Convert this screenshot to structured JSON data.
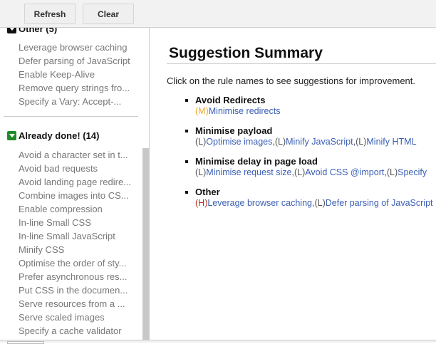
{
  "toolbar": {
    "refresh": "Refresh",
    "clear": "Clear"
  },
  "sidebar": {
    "other": {
      "label": "Other (5)",
      "items": [
        "Leverage browser caching",
        "Defer parsing of JavaScript",
        "Enable Keep-Alive",
        "Remove query strings fro...",
        "Specify a Vary: Accept-..."
      ]
    },
    "done": {
      "label": "Already done! (14)",
      "items": [
        "Avoid a character set in t...",
        "Avoid bad requests",
        "Avoid landing page redire...",
        "Combine images into CS...",
        "Enable compression",
        "In-line Small CSS",
        "In-line Small JavaScript",
        "Minify CSS",
        "Optimise the order of sty...",
        "Prefer asynchronous res...",
        "Put CSS in the documen...",
        "Serve resources from a ...",
        "Serve scaled images",
        "Specify a cache validator"
      ]
    }
  },
  "main": {
    "title": "Suggestion Summary",
    "intro": "Click on the rule names to see suggestions for improvement.",
    "rules": [
      {
        "title": "Avoid Redirects",
        "links": [
          {
            "p": "(M)",
            "c": "#f0a830",
            "t": "Minimise redirects"
          }
        ]
      },
      {
        "title": "Minimise payload",
        "links": [
          {
            "p": "(L)",
            "c": "#555",
            "t": "Optimise images"
          },
          {
            "p": "(L)",
            "c": "#555",
            "t": "Minify JavaScript"
          },
          {
            "p": "(L)",
            "c": "#555",
            "t": "Minify HTML"
          }
        ]
      },
      {
        "title": "Minimise delay in page load",
        "links": [
          {
            "p": "(L)",
            "c": "#555",
            "t": "Minimise request size"
          },
          {
            "p": "(L)",
            "c": "#555",
            "t": "Avoid CSS @import"
          },
          {
            "p": "(L)",
            "c": "#555",
            "t": "Specify"
          }
        ]
      },
      {
        "title": "Other",
        "links": [
          {
            "p": "(H)",
            "c": "#c03020",
            "t": "Leverage browser caching"
          },
          {
            "p": "(L)",
            "c": "#555",
            "t": "Defer parsing of JavaScript"
          }
        ]
      }
    ]
  },
  "colors": {
    "other_box": "#111111",
    "done_box": "#1e8c2a"
  }
}
